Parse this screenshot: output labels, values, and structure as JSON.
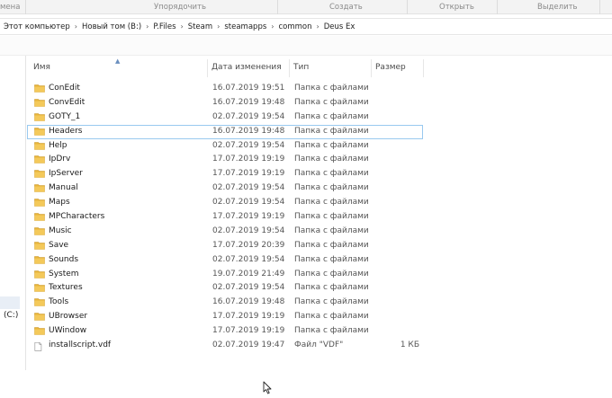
{
  "ribbon": {
    "groups": [
      "мена",
      "Упорядочить",
      "Создать",
      "Открыть",
      "Выделить"
    ]
  },
  "address": {
    "crumbs": [
      "Этот компьютер",
      "Новый том (B:)",
      "P.Files",
      "Steam",
      "steamapps",
      "common",
      "Deus Ex"
    ]
  },
  "nav": {
    "drive_label": "(C:)"
  },
  "columns": {
    "name": "Имя",
    "date": "Дата изменения",
    "type": "Тип",
    "size": "Размер"
  },
  "files": [
    {
      "name": "ConEdit",
      "date": "16.07.2019 19:51",
      "type": "Папка с файлами",
      "size": "",
      "kind": "folder"
    },
    {
      "name": "ConvEdit",
      "date": "16.07.2019 19:48",
      "type": "Папка с файлами",
      "size": "",
      "kind": "folder"
    },
    {
      "name": "GOTY_1",
      "date": "02.07.2019 19:54",
      "type": "Папка с файлами",
      "size": "",
      "kind": "folder"
    },
    {
      "name": "Headers",
      "date": "16.07.2019 19:48",
      "type": "Папка с файлами",
      "size": "",
      "kind": "folder",
      "selected": true
    },
    {
      "name": "Help",
      "date": "02.07.2019 19:54",
      "type": "Папка с файлами",
      "size": "",
      "kind": "folder"
    },
    {
      "name": "IpDrv",
      "date": "17.07.2019 19:19",
      "type": "Папка с файлами",
      "size": "",
      "kind": "folder"
    },
    {
      "name": "IpServer",
      "date": "17.07.2019 19:19",
      "type": "Папка с файлами",
      "size": "",
      "kind": "folder"
    },
    {
      "name": "Manual",
      "date": "02.07.2019 19:54",
      "type": "Папка с файлами",
      "size": "",
      "kind": "folder"
    },
    {
      "name": "Maps",
      "date": "02.07.2019 19:54",
      "type": "Папка с файлами",
      "size": "",
      "kind": "folder"
    },
    {
      "name": "MPCharacters",
      "date": "17.07.2019 19:19",
      "type": "Папка с файлами",
      "size": "",
      "kind": "folder"
    },
    {
      "name": "Music",
      "date": "02.07.2019 19:54",
      "type": "Папка с файлами",
      "size": "",
      "kind": "folder"
    },
    {
      "name": "Save",
      "date": "17.07.2019 20:39",
      "type": "Папка с файлами",
      "size": "",
      "kind": "folder"
    },
    {
      "name": "Sounds",
      "date": "02.07.2019 19:54",
      "type": "Папка с файлами",
      "size": "",
      "kind": "folder"
    },
    {
      "name": "System",
      "date": "19.07.2019 21:49",
      "type": "Папка с файлами",
      "size": "",
      "kind": "folder"
    },
    {
      "name": "Textures",
      "date": "02.07.2019 19:54",
      "type": "Папка с файлами",
      "size": "",
      "kind": "folder"
    },
    {
      "name": "Tools",
      "date": "16.07.2019 19:48",
      "type": "Папка с файлами",
      "size": "",
      "kind": "folder"
    },
    {
      "name": "UBrowser",
      "date": "17.07.2019 19:19",
      "type": "Папка с файлами",
      "size": "",
      "kind": "folder"
    },
    {
      "name": "UWindow",
      "date": "17.07.2019 19:19",
      "type": "Папка с файлами",
      "size": "",
      "kind": "folder"
    },
    {
      "name": "installscript.vdf",
      "date": "02.07.2019 19:47",
      "type": "Файл \"VDF\"",
      "size": "1 КБ",
      "kind": "file"
    }
  ],
  "colors": {
    "folder": "#e8b53a",
    "selection_border": "#99c9ef"
  }
}
